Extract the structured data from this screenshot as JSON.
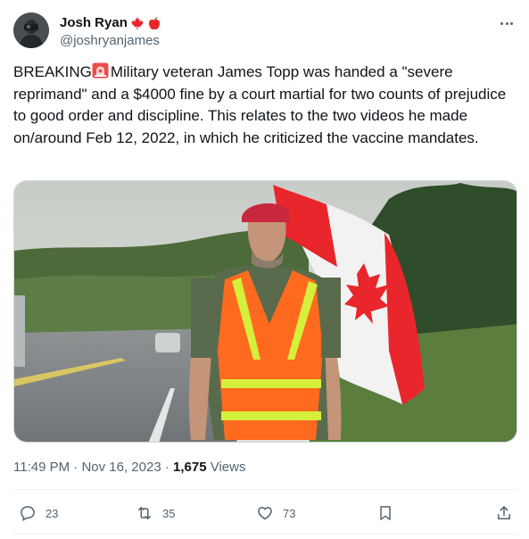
{
  "author": {
    "display_name": "Josh Ryan",
    "handle": "@joshryanjames",
    "name_emojis": [
      "maple-leaf-icon",
      "apple-icon"
    ]
  },
  "tweet": {
    "text_before_emoji": "BREAKING",
    "text_after_emoji": "Military veteran James Topp was handed a \"severe reprimand\" and a $4000 fine by a court martial for two counts of prejudice to good order and discipline.  This relates to the two videos he made on/around Feb 12, 2022, in which he criticized the vaccine mandates."
  },
  "meta": {
    "time": "11:49 PM",
    "separator1": " · ",
    "date": "Nov 16, 2023",
    "separator2": " · ",
    "views_count": "1,675",
    "views_label": " Views"
  },
  "actions": {
    "replies": "23",
    "reposts": "35",
    "likes": "73"
  },
  "colors": {
    "text": "#0f1419",
    "secondary": "#536471",
    "divider": "#eff3f4",
    "canada_red": "#e8262b"
  }
}
